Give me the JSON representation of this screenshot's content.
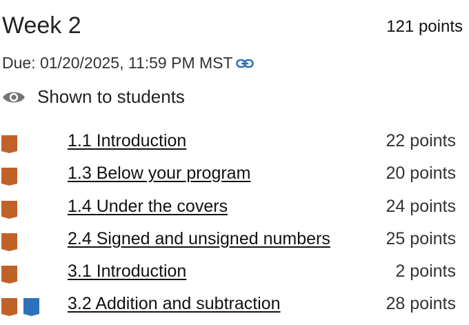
{
  "header": {
    "title": "Week 2",
    "total_points": "121 points",
    "due": "Due: 01/20/2025, 11:59 PM MST",
    "link_icon": "link-icon",
    "visibility_icon": "eye-icon",
    "visibility": "Shown to students"
  },
  "colors": {
    "badge_orange": "#C0612A",
    "badge_blue": "#2F71B8",
    "link_blue": "#2F71B8",
    "eye_gray": "#757575"
  },
  "rows": [
    {
      "title": "1.1 Introduction",
      "points": "22 points",
      "badges": [
        "orange"
      ]
    },
    {
      "title": "1.3 Below your program",
      "points": "20 points",
      "badges": [
        "orange"
      ]
    },
    {
      "title": "1.4 Under the covers",
      "points": "24 points",
      "badges": [
        "orange"
      ]
    },
    {
      "title": "2.4 Signed and unsigned numbers",
      "points": "25 points",
      "badges": [
        "orange"
      ]
    },
    {
      "title": "3.1 Introduction",
      "points": "2 points",
      "badges": [
        "orange"
      ]
    },
    {
      "title": "3.2 Addition and subtraction",
      "points": "28 points",
      "badges": [
        "orange",
        "blue"
      ]
    }
  ]
}
